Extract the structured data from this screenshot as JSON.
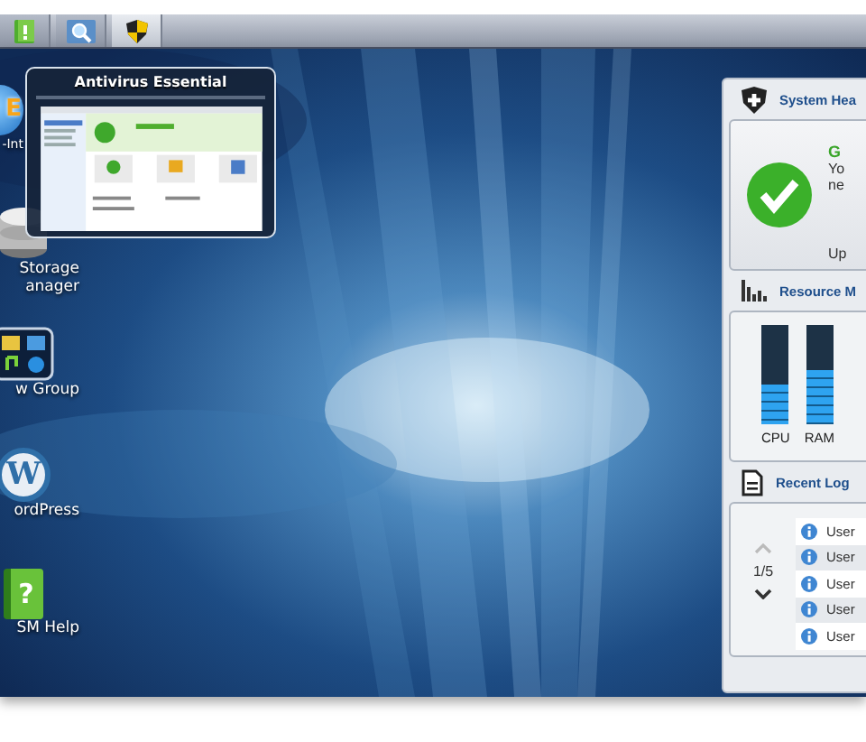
{
  "taskbar": {
    "buttons": [
      {
        "kind": "help",
        "selected": false
      },
      {
        "kind": "search",
        "selected": false
      },
      {
        "kind": "antivirus",
        "selected": true
      }
    ]
  },
  "preview": {
    "title": "Antivirus Essential"
  },
  "desktop_icons": [
    {
      "kind": "globe",
      "logo_text": "E",
      "lines": [
        "-Int"
      ]
    },
    {
      "kind": "storage",
      "lines": [
        "Storage",
        "anager"
      ]
    },
    {
      "kind": "group",
      "lines": [
        "w Group"
      ]
    },
    {
      "kind": "wordpress",
      "logo_text": "W",
      "lines": [
        "ordPress"
      ]
    },
    {
      "kind": "help",
      "logo_text": "?",
      "lines": [
        "SM Help"
      ]
    }
  ],
  "widgets": {
    "health": {
      "title": "System Hea",
      "status": "G",
      "line_1": "Yo",
      "line_2": "ne",
      "footer": "Up"
    },
    "resource": {
      "title": "Resource M",
      "meters": [
        {
          "name": "CPU",
          "level": 0.4
        },
        {
          "name": "RAM",
          "level": 0.55
        }
      ]
    },
    "logs": {
      "title": "Recent Log",
      "page": "1/5",
      "rows": [
        {
          "text": "User"
        },
        {
          "text": "User"
        },
        {
          "text": "User"
        },
        {
          "text": "User"
        },
        {
          "text": "User"
        }
      ]
    }
  }
}
